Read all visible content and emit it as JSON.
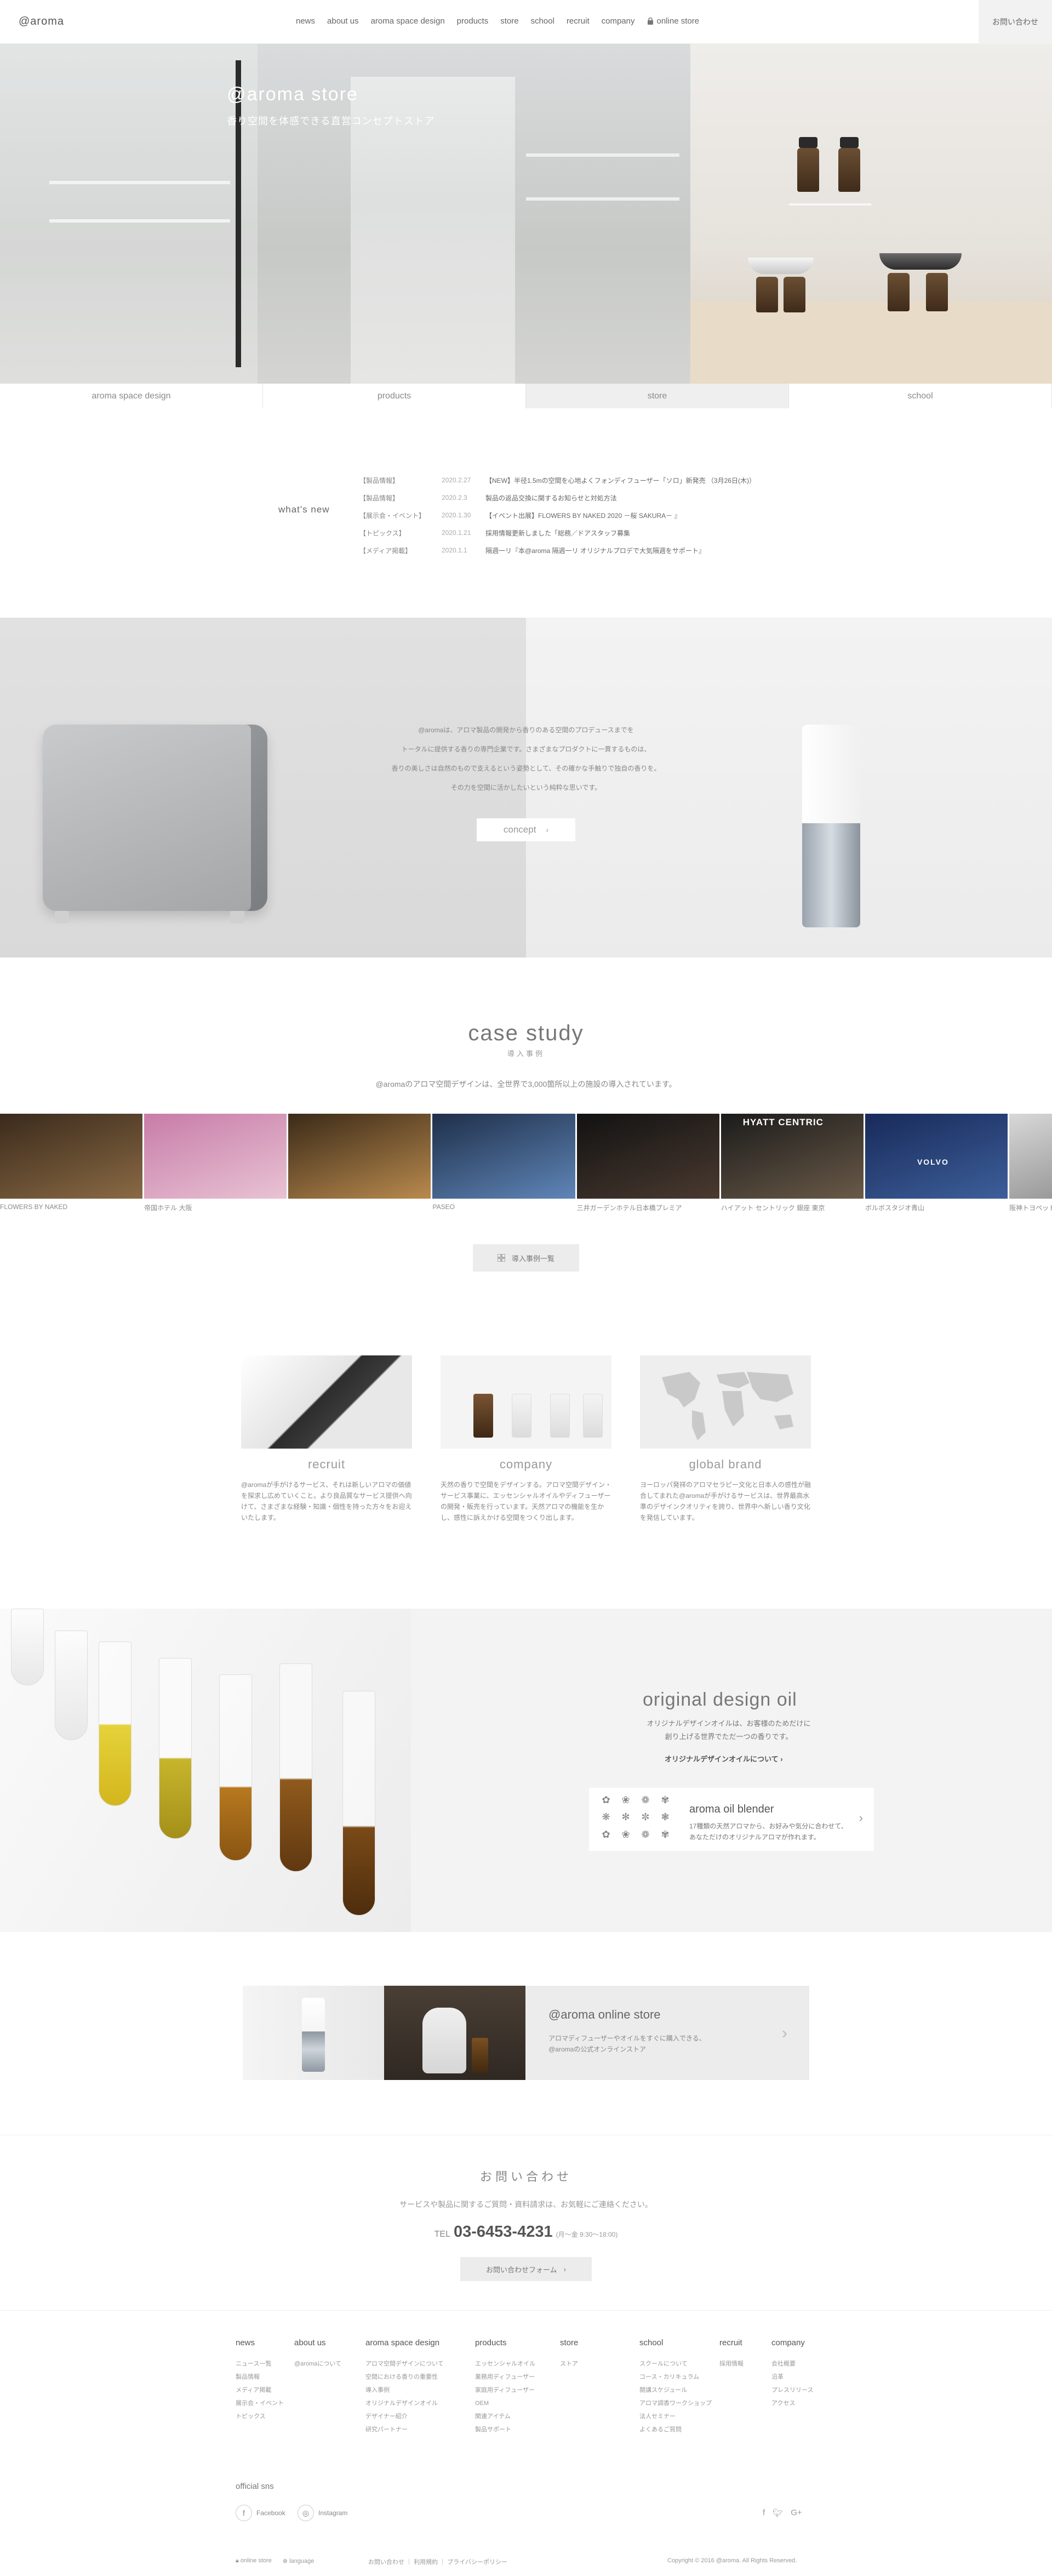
{
  "header": {
    "logo": "@aroma",
    "nav": [
      "news",
      "about us",
      "aroma space design",
      "products",
      "store",
      "school",
      "recruit",
      "company"
    ],
    "online_store": "online store",
    "contact": "お問い合わせ"
  },
  "hero": {
    "title": "@aroma store",
    "subtitle": "香り空間を体感できる直営コンセプトストア"
  },
  "tabs": [
    "aroma space design",
    "products",
    "store",
    "school"
  ],
  "tabs_active": "store",
  "news": {
    "label": "what's new",
    "items": [
      {
        "category": "【製品情報】",
        "date": "2020.2.27",
        "title": "【NEW】半径1.5mの空間を心地よくフォンディフューザー「ソロ」新発売 （3月26日(木)）"
      },
      {
        "category": "【製品情報】",
        "date": "2020.2.3",
        "title": "製品の返品交換に関するお知らせと対処方法"
      },
      {
        "category": "【展示会・イベント】",
        "date": "2020.1.30",
        "title": "【イベント出展】FLOWERS BY NAKED 2020 －桜 SAKURA－ 』"
      },
      {
        "category": "【トピックス】",
        "date": "2020.1.21",
        "title": "採用情報更新しました「総務／ドアスタッフ募集"
      },
      {
        "category": "【メディア掲載】",
        "date": "2020.1.1",
        "title": "隔週一リ『本@aroma 隔週一リ オリジナルプロデで大気隔週をサポート』"
      }
    ]
  },
  "concept": {
    "lines": [
      "@aromaは、アロマ製品の開発から香りのある空間のプロデュースまでを",
      "トータルに提供する香りの専門企業です。さまざまなプロダクトに一貫するものは、",
      "香りの美しさは自然のもので支えるという姿勢として、その確かな手触りで独自の香りを。",
      "その力を空間に活かしたいという純粋な思いです。"
    ],
    "button": "concept"
  },
  "case_study": {
    "title": "case study",
    "subtitle": "導入事例",
    "description": "@aromaのアロマ空間デザインは、全世界で3,000箇所以上の施設の導入されています。",
    "items": [
      {
        "label": "FLOWERS BY NAKED",
        "colors": [
          "#3a2a1c",
          "#8a6a44"
        ]
      },
      {
        "label": "帝国ホテル 大阪",
        "colors": [
          "#c87ca8",
          "#e8c3d4"
        ]
      },
      {
        "label": "",
        "colors": [
          "#3b2a18",
          "#b98a4e"
        ]
      },
      {
        "label": "PASEO",
        "colors": [
          "#1f2f4a",
          "#5f86b8"
        ]
      },
      {
        "label": "三井ガーデンホテル日本橋プレミア",
        "colors": [
          "#121212",
          "#4a3a30"
        ]
      },
      {
        "label": "ハイアット セントリック 銀座 東京",
        "colors": [
          "#1b1b1b",
          "#6a5a48"
        ]
      },
      {
        "label": "ボルボスタジオ青山",
        "colors": [
          "#182a5a",
          "#3d5f9a"
        ]
      },
      {
        "label": "阪神トヨペット",
        "colors": [
          "#d8d8d8",
          "#9a9a9a"
        ]
      }
    ],
    "hyatt_sign": "HYATT CENTRIC",
    "volvo_sign": "VOLVO",
    "button": "導入事例一覧"
  },
  "columns": [
    {
      "title": "recruit",
      "text": "@aromaが手がけるサービス、それは新しいアロマの価値を探求し広めていくこと。より良品質なサービス提供へ向けて、さまざまな経験・知識・個性を持った方々をお迎えいたします。"
    },
    {
      "title": "company",
      "text": "天然の香りで空間をデザインする。アロマ空間デザイン・サービス事業に、エッセンシャルオイルやディフューザーの開発・販売を行っています。天然アロマの機能を生かし、感性に訴えかける空間をつくり出します。"
    },
    {
      "title": "global brand",
      "text": "ヨーロッパ発祥のアロマセラピー文化と日本人の感性が融合してまれた@aromaが手がけるサービスは、世界最高水準のデザインクオリティを誇り、世界中へ新しい香り文化を発信しています。"
    }
  ],
  "oil": {
    "title": "original design oil",
    "desc1": "オリジナルデザインオイルは、お客様のためだけに",
    "desc2": "創り上げる世界でただ一つの香りです。",
    "link": "オリジナルデザインオイルについて",
    "blender_title": "aroma oil blender",
    "blender_desc1": "17種類の天然アロマから、お好みや気分に合わせて、",
    "blender_desc2": "あなただけのオリジナルアロマが作れます。",
    "blender_icons": [
      "✿",
      "❀",
      "❁",
      "✾",
      "❋",
      "✻",
      "✼",
      "❃",
      "✿",
      "❀",
      "❁",
      "✾"
    ]
  },
  "store": {
    "title": "@aroma online store",
    "desc1": "アロマディフューザーやオイルをすぐに購入できる、",
    "desc2": "@aromaの公式オンラインストア"
  },
  "contact": {
    "title": "お問い合わせ",
    "desc": "サービスや製品に関するご質問・資料請求は、お気軽にご連絡ください。",
    "tel_label": "TEL",
    "tel": "03-6453-4231",
    "hours": "(月〜金 9:30〜18:00)",
    "button": "お問い合わせフォーム"
  },
  "footer": {
    "columns": [
      {
        "heading": "news",
        "items": [
          "ニュース一覧",
          "製品情報",
          "メディア掲載",
          "展示会・イベント",
          "トピックス"
        ]
      },
      {
        "heading": "about us",
        "items": [
          "@aromaについて"
        ]
      },
      {
        "heading": "aroma space design",
        "items": [
          "アロマ空間デザインについて",
          "空間における香りの重要性",
          "導入事例",
          "オリジナルデザインオイル",
          "デザイナー紹介",
          "研究パートナー"
        ]
      },
      {
        "heading": "products",
        "items": [
          "エッセンシャルオイル",
          "業務用ディフューザー",
          "家庭用ディフューザー",
          "OEM",
          "関連アイテム",
          "製品サポート"
        ]
      },
      {
        "heading": "store",
        "items": [
          "ストア"
        ]
      },
      {
        "heading": "school",
        "items": [
          "スクールについて",
          "コース・カリキュラム",
          "開講スケジュール",
          "アロマ調香ワークショップ",
          "法人セミナー",
          "よくあるご質問"
        ]
      },
      {
        "heading": "recruit",
        "items": [
          "採用情報"
        ]
      },
      {
        "heading": "company",
        "items": [
          "会社概要",
          "沿革",
          "プレスリリース",
          "アクセス"
        ]
      }
    ],
    "sns_label": "official sns",
    "facebook": "Facebook",
    "instagram": "Instagram",
    "bottom_store": "online store",
    "bottom_language": "language",
    "bottom_links": "お問い合わせ ｜ 利用規約 ｜ プライバシーポリシー",
    "copyright": "Copyright © 2016 @aroma. All Rights Reserved."
  }
}
